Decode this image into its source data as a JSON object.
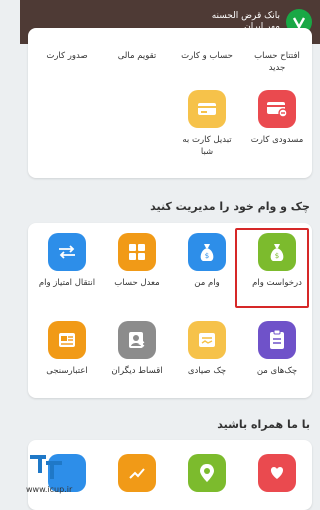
{
  "header": {
    "brand_line1": "بانک قرض الحسنه",
    "brand_line2": "مهر ایران"
  },
  "card1": {
    "items_top": [
      {
        "label": "افتتاح حساب جدید"
      },
      {
        "label": "حساب و کارت"
      },
      {
        "label": "تقویم مالی"
      },
      {
        "label": "صدور کارت"
      }
    ],
    "items_bottom": [
      {
        "label": "مسدودی کارت",
        "icon": "card-block-icon",
        "color": "#ea4a4f"
      },
      {
        "label": "تبدیل کارت به شبا",
        "icon": "card-convert-icon",
        "color": "#f6c24a"
      }
    ]
  },
  "section_cheques": {
    "title": "چک و وام خود را مدیریت کنید",
    "row1": [
      {
        "label": "درخواست وام",
        "icon": "loan-bag-icon",
        "color": "#7cbb2d"
      },
      {
        "label": "وام من",
        "icon": "money-bag-icon",
        "color": "#2d8ee9"
      },
      {
        "label": "معدل حساب",
        "icon": "calculator-icon",
        "color": "#f19a17"
      },
      {
        "label": "انتقال امتیاز وام",
        "icon": "transfer-icon",
        "color": "#2d8ee9"
      }
    ],
    "row2": [
      {
        "label": "چک‌های من",
        "icon": "cheque-list-icon",
        "color": "#6f52c9"
      },
      {
        "label": "چک صیادی",
        "icon": "cheque-icon",
        "color": "#f6c24a"
      },
      {
        "label": "اقساط دیگران",
        "icon": "user-installment-icon",
        "color": "#8c8c8c"
      },
      {
        "label": "اعتبارسنجی",
        "icon": "credit-score-icon",
        "color": "#f19a17"
      }
    ]
  },
  "section_contact": {
    "title": "با ما همراه باشید",
    "items": [
      {
        "icon": "heart-hands-icon",
        "color": "#ea4a4f"
      },
      {
        "icon": "location-icon",
        "color": "#7cbb2d"
      },
      {
        "icon": "chart-icon",
        "color": "#f19a17"
      },
      {
        "icon": "social-icon",
        "color": "#2d8ee9"
      }
    ]
  },
  "watermark": {
    "url": "www.icup.ir"
  }
}
